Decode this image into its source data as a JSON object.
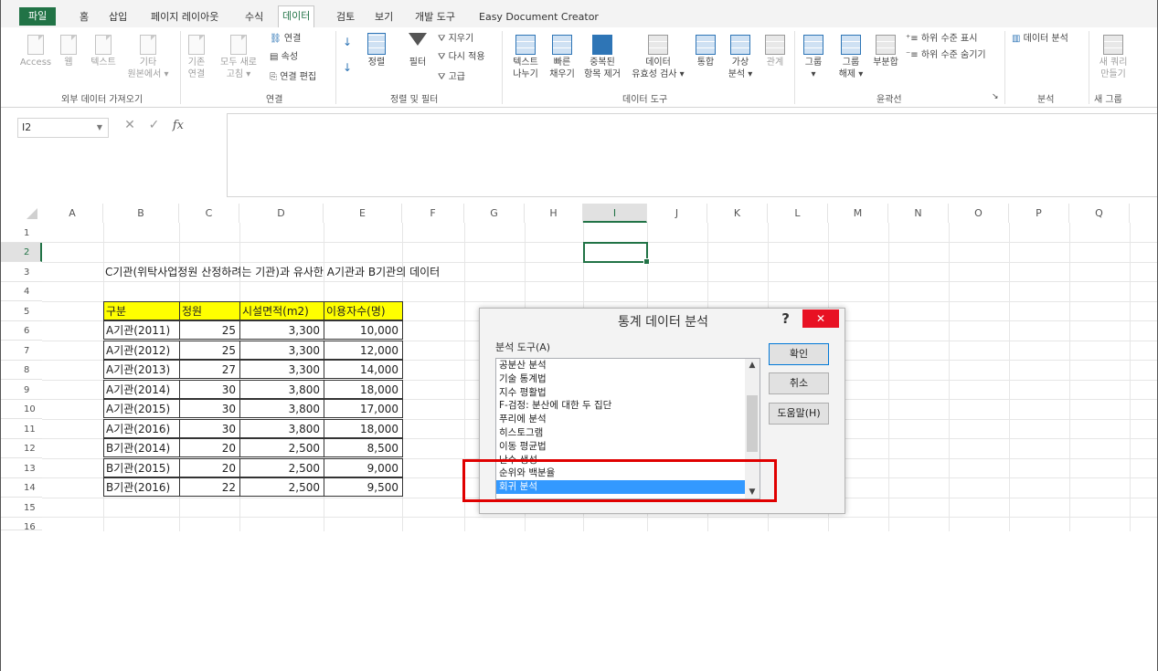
{
  "tabs": [
    "파일",
    "홈",
    "삽입",
    "페이지 레이아웃",
    "수식",
    "데이터",
    "검토",
    "보기",
    "개발 도구",
    "Easy Document Creator"
  ],
  "active_tab": "데이터",
  "ribbon": {
    "external": {
      "access": "Access",
      "web": "웹",
      "text": "텍스트",
      "other_1": "기타",
      "other_2": "원본에서 ▾",
      "group": "외부 데이터 가져오기"
    },
    "connections": {
      "existing_1": "기존",
      "existing_2": "연결",
      "refresh_1": "모두 새로",
      "refresh_2": "고침 ▾",
      "connections": "연결",
      "properties": "속성",
      "edit_links": "연결 편집",
      "group": "연결"
    },
    "sort_filter": {
      "sort": "정렬",
      "filter": "필터",
      "clear": "지우기",
      "reapply": "다시 적용",
      "advanced": "고급",
      "group": "정렬 및 필터"
    },
    "data_tools": {
      "text_to_col_1": "텍스트",
      "text_to_col_2": "나누기",
      "flash_fill_1": "빠른",
      "flash_fill_2": "채우기",
      "remove_dup_1": "중복된",
      "remove_dup_2": "항목 제거",
      "validation_1": "데이터",
      "validation_2": "유효성 검사 ▾",
      "consolidate": "통합",
      "whatif_1": "가상",
      "whatif_2": "분석 ▾",
      "relationships": "관계",
      "group": "데이터 도구"
    },
    "outline": {
      "group_btn_1": "그룹",
      "group_btn_2": "▾",
      "ungroup_1": "그룹",
      "ungroup_2": "해제 ▾",
      "subtotal": "부분합",
      "show_detail": "하위 수준 표시",
      "hide_detail": "하위 수준 숨기기",
      "group": "윤곽선"
    },
    "analysis": {
      "data_analysis": "데이터 분석",
      "group": "분석"
    },
    "new_query": {
      "label_1": "새 쿼리",
      "label_2": "만들기",
      "group": "새 그룹"
    }
  },
  "formula_bar": {
    "name_box": "I2",
    "cancel": "✕",
    "enter": "✓",
    "fx": "fx",
    "content": ""
  },
  "columns": [
    "A",
    "B",
    "C",
    "D",
    "E",
    "F",
    "G",
    "H",
    "I",
    "J",
    "K",
    "L",
    "M",
    "N",
    "O",
    "P",
    "Q"
  ],
  "selected_column": "I",
  "rows": [
    "1",
    "2",
    "3",
    "4",
    "5",
    "6",
    "7",
    "8",
    "9",
    "10",
    "11",
    "12",
    "13",
    "14",
    "15",
    "16"
  ],
  "selected_row": "2",
  "sheet": {
    "title": "C기관(위탁사업정원 산정하려는 기관)과 유사한 A기관과 B기관의 데이터",
    "headers": [
      "구분",
      "정원",
      "시설면적(m2)",
      "이용자수(명)"
    ],
    "data": [
      [
        "A기관(2011)",
        "25",
        "3,300",
        "10,000"
      ],
      [
        "A기관(2012)",
        "25",
        "3,300",
        "12,000"
      ],
      [
        "A기관(2013)",
        "27",
        "3,300",
        "14,000"
      ],
      [
        "A기관(2014)",
        "30",
        "3,800",
        "18,000"
      ],
      [
        "A기관(2015)",
        "30",
        "3,800",
        "17,000"
      ],
      [
        "A기관(2016)",
        "30",
        "3,800",
        "18,000"
      ],
      [
        "B기관(2014)",
        "20",
        "2,500",
        "8,500"
      ],
      [
        "B기관(2015)",
        "20",
        "2,500",
        "9,000"
      ],
      [
        "B기관(2016)",
        "22",
        "2,500",
        "9,500"
      ]
    ]
  },
  "dialog": {
    "title": "통계 데이터 분석",
    "help": "?",
    "close": "✕",
    "label": "분석 도구(A)",
    "items": [
      "공분산 분석",
      "기술 통계법",
      "지수 평활법",
      "F-검정: 분산에 대한 두 집단",
      "푸리에 분석",
      "히스토그램",
      "이동 평균법",
      "난수 생성",
      "순위와 백분율",
      "회귀 분석"
    ],
    "selected_item": "회귀 분석",
    "ok": "확인",
    "cancel": "취소",
    "help_button": "도움말(H)"
  },
  "colors": {
    "excel_green": "#217346",
    "header_fill": "#ffff00",
    "selection_blue": "#3399ff",
    "highlight_red": "#e00000"
  }
}
